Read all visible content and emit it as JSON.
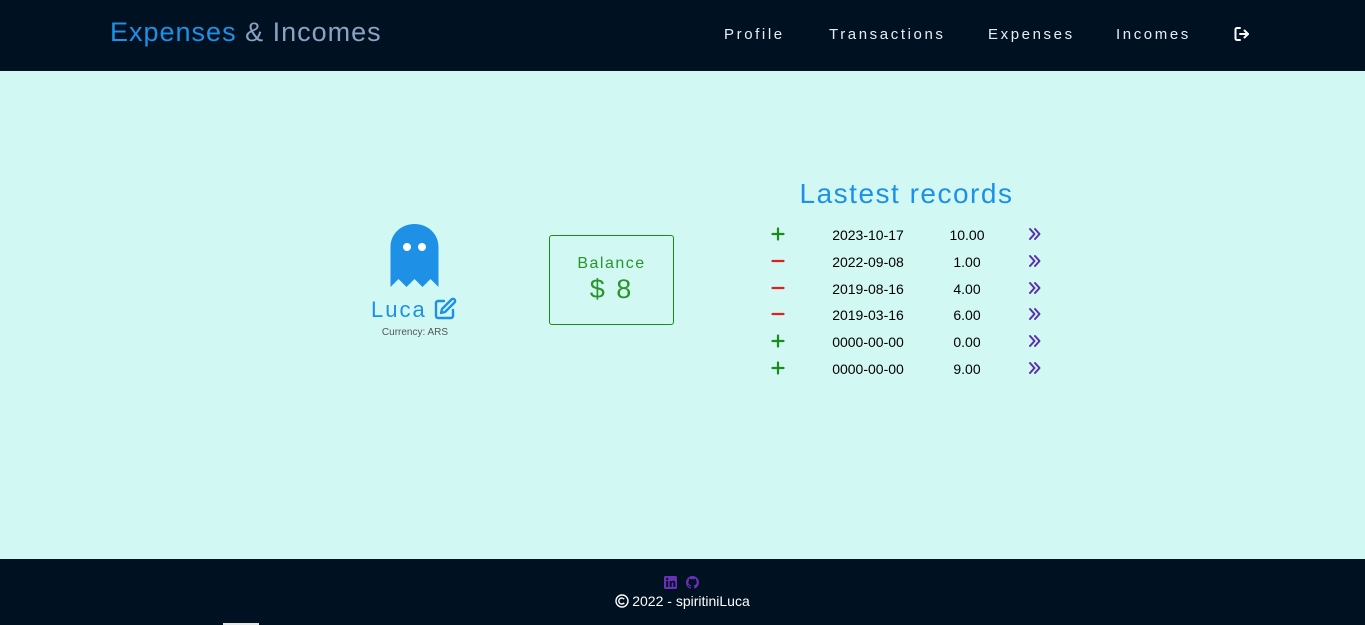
{
  "navbar": {
    "brand_part1": "Expenses",
    "brand_part2": " & Incomes",
    "links": [
      "Profile",
      "Transactions",
      "Expenses",
      "Incomes"
    ],
    "logout_icon": "logout-icon"
  },
  "profile": {
    "avatar_icon": "ghost-icon",
    "name": "Luca",
    "edit_icon": "edit-icon",
    "currency": "Currency: ARS"
  },
  "balance": {
    "label": "Balance",
    "value": "$ 8"
  },
  "records": {
    "title": "Lastest records",
    "rows": [
      {
        "type": "income",
        "date": "2023-10-17",
        "amount": "10.00"
      },
      {
        "type": "expense",
        "date": "2022-09-08",
        "amount": "1.00"
      },
      {
        "type": "expense",
        "date": "2019-08-16",
        "amount": "4.00"
      },
      {
        "type": "expense",
        "date": "2019-03-16",
        "amount": "6.00"
      },
      {
        "type": "income",
        "date": "0000-00-00",
        "amount": "0.00"
      },
      {
        "type": "income",
        "date": "0000-00-00",
        "amount": "9.00"
      }
    ]
  },
  "footer": {
    "social_icons": [
      "linkedin-icon",
      "github-icon"
    ],
    "copyright_icon": "copyright-icon",
    "copyright": "2022 - spiritiniLuca"
  },
  "colors": {
    "navbar_bg": "#001122",
    "page_bg": "#d2f8f3",
    "accent_blue": "#1e90e6",
    "income_green": "#1a8c1a",
    "expense_red": "#e02020",
    "detail_purple": "#5a2fa8"
  }
}
